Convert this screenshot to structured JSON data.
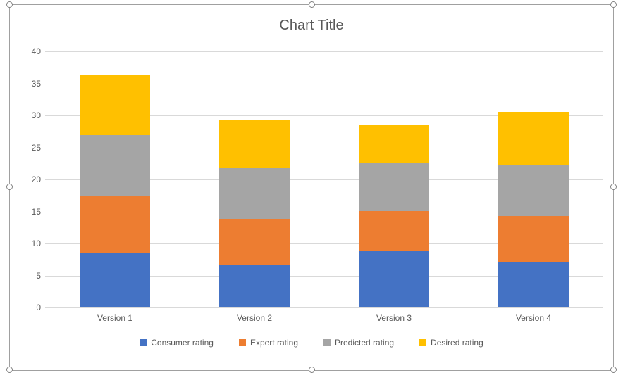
{
  "title": "Chart Title",
  "legend": [
    {
      "name": "Consumer rating",
      "color": "#4472c4"
    },
    {
      "name": "Expert rating",
      "color": "#ed7d31"
    },
    {
      "name": "Predicted rating",
      "color": "#a5a5a5"
    },
    {
      "name": "Desired rating",
      "color": "#ffc000"
    }
  ],
  "chart_data": {
    "type": "bar",
    "stacked": true,
    "title": "Chart Title",
    "xlabel": "",
    "ylabel": "",
    "categories": [
      "Version 1",
      "Version 2",
      "Version 3",
      "Version 4"
    ],
    "series": [
      {
        "name": "Consumer rating",
        "values": [
          8.5,
          6.6,
          8.8,
          7.0
        ]
      },
      {
        "name": "Expert rating",
        "values": [
          8.9,
          7.3,
          6.3,
          7.3
        ]
      },
      {
        "name": "Predicted rating",
        "values": [
          9.5,
          7.9,
          7.5,
          8.0
        ]
      },
      {
        "name": "Desired rating",
        "values": [
          9.5,
          7.5,
          6.0,
          8.3
        ]
      }
    ],
    "ylim": [
      0,
      40
    ],
    "yticks": [
      0,
      5,
      10,
      15,
      20,
      25,
      30,
      35,
      40
    ],
    "grid": true,
    "legend_position": "bottom"
  }
}
